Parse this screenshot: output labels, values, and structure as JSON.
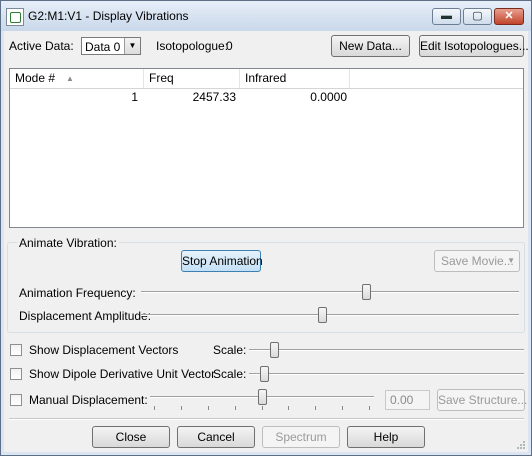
{
  "window": {
    "title": "G2:M1:V1 - Display Vibrations",
    "minimize_glyph": "▬",
    "maximize_glyph": "▢",
    "close_glyph": "✕"
  },
  "top": {
    "active_data_label": "Active Data:",
    "active_data_value": "Data 0",
    "isotopologue_label": "Isotopologue:",
    "isotopologue_value": "0",
    "new_data_button": "New Data...",
    "edit_isotopologues_button": "Edit Isotopologues..."
  },
  "table": {
    "columns": [
      "Mode #",
      "Freq",
      "Infrared"
    ],
    "sort_indicator": "▲",
    "rows": [
      {
        "mode": "1",
        "freq": "2457.33",
        "infrared": "0.0000"
      }
    ]
  },
  "animate": {
    "group_title": "Animate Vibration:",
    "stop_button": "Stop Animation",
    "save_movie_button": "Save Movie...",
    "frequency_label": "Animation Frequency:",
    "frequency_level": 0.6,
    "amplitude_label": "Displacement Amplitude:",
    "amplitude_level": 0.48
  },
  "options": {
    "show_vectors_label": "Show Displacement Vectors",
    "show_vectors_checked": false,
    "vectors_scale_label": "Scale:",
    "vectors_scale_level": 0.08,
    "show_dipole_label": "Show Dipole Derivative Unit Vector",
    "show_dipole_checked": false,
    "dipole_scale_label": "Scale:",
    "dipole_scale_level": 0.04,
    "manual_label": "Manual Displacement:",
    "manual_checked": false,
    "manual_level": 0.5,
    "manual_value": "0.00",
    "save_structure_button": "Save Structure..."
  },
  "footer": {
    "close_button": "Close",
    "cancel_button": "Cancel",
    "spectrum_button": "Spectrum",
    "help_button": "Help"
  }
}
